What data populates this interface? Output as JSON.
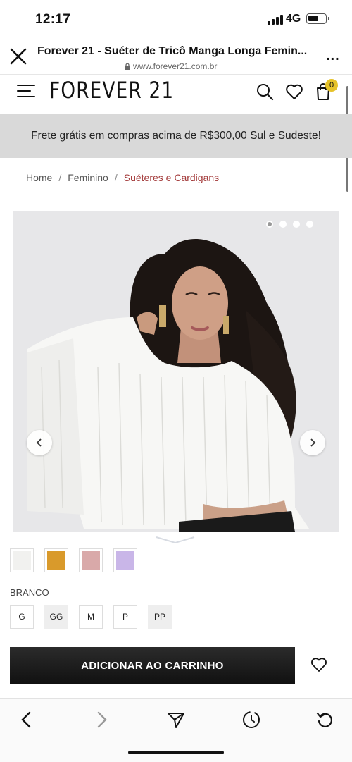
{
  "status_bar": {
    "time": "12:17",
    "network": "4G"
  },
  "browser": {
    "title": "Forever 21 - Suéter de Tricô Manga Longa Femin...",
    "url": "www.forever21.com.br",
    "more": "..."
  },
  "site": {
    "logo": "FOREVER 21",
    "cart_count": "0",
    "promo": "Frete grátis em compras acima de R$300,00 Sul e Sudeste!"
  },
  "breadcrumb": {
    "items": [
      "Home",
      "Feminino",
      "Suéteres e Cardigans"
    ],
    "separator": "/"
  },
  "gallery": {
    "image_count": 4,
    "active_index": 0
  },
  "swatches": [
    {
      "color": "#f1f1ef"
    },
    {
      "color": "#d99a2b"
    },
    {
      "color": "#d9a9a9"
    },
    {
      "color": "#c9b6e8"
    }
  ],
  "selected_color": "BRANCO",
  "sizes": [
    "G",
    "GG",
    "M",
    "P",
    "PP"
  ],
  "add_to_cart_label": "ADICIONAR AO CARRINHO",
  "colors": {
    "accent_breadcrumb": "#a33a3a",
    "cart_badge": "#e6c229",
    "promo_bg": "#d9d9d9"
  }
}
